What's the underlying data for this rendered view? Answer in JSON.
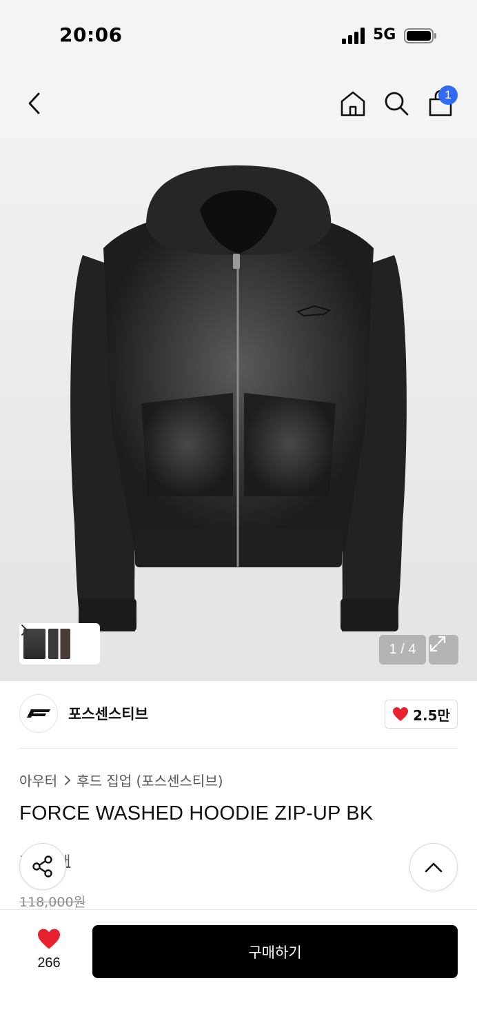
{
  "status_bar": {
    "time": "20:06",
    "network": "5G"
  },
  "nav": {
    "cart_badge": "1",
    "icons": [
      "back-icon",
      "home-icon",
      "search-icon",
      "cart-icon"
    ]
  },
  "gallery": {
    "counter": "1 / 4",
    "icons": [
      "chevron-right-icon",
      "expand-icon"
    ]
  },
  "brand": {
    "name": "포스센스티브",
    "like_count": "2.5만"
  },
  "product": {
    "breadcrumb": [
      "아우터",
      "후드 집업 (포스센스티브)"
    ],
    "title": "FORCE WASHED HOODIE ZIP-UP BK",
    "review_link": "후기 6개",
    "original_price": "118,000원"
  },
  "bottom_bar": {
    "wish_count": "266",
    "buy_label": "구매하기"
  },
  "colors": {
    "accent_badge": "#2f6bf5",
    "heart": "#e8232f",
    "buy_button": "#000000"
  }
}
